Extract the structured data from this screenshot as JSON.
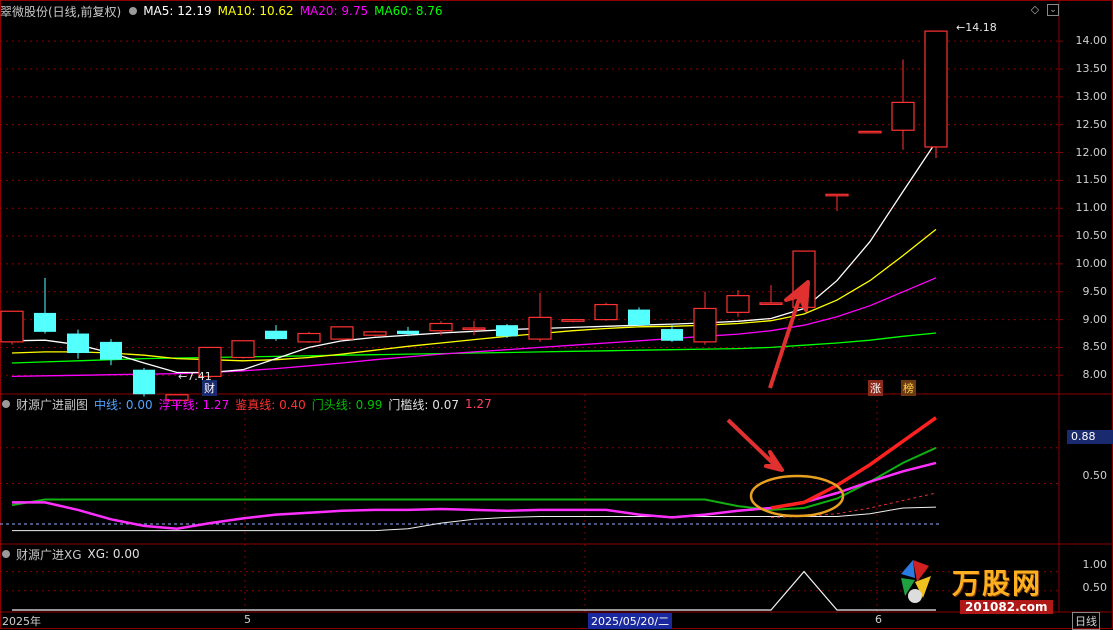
{
  "main_header": {
    "stock": "翠微股份(日线,前复权)",
    "ma5_label": "MA5:",
    "ma5_value": "12.19",
    "ma10_label": "MA10:",
    "ma10_value": "10.62",
    "ma20_label": "MA20:",
    "ma20_value": "9.75",
    "ma60_label": "MA60:",
    "ma60_value": "8.76"
  },
  "sub1_header": {
    "title": "财源广进副图",
    "mid_label": "中线:",
    "mid_value": "0.00",
    "float_label": "浮平线:",
    "float_value": "1.27",
    "true_label": "鉴真线:",
    "true_value": "0.40",
    "door_label": "门头线:",
    "door_value": "0.99",
    "thresh_label": "门槛线:",
    "thresh_value": "0.07",
    "thresh_extra": "1.27"
  },
  "sub2_header": {
    "title": "财源广进XG",
    "xg_label": "XG:",
    "xg_value": "0.00"
  },
  "price_axis": [
    "14.00",
    "13.50",
    "13.00",
    "12.50",
    "12.00",
    "11.50",
    "11.00",
    "10.50",
    "10.00",
    "9.50",
    "9.00",
    "8.50",
    "8.00"
  ],
  "sub1_axis": {
    "current": "0.88",
    "mid": "0.50"
  },
  "sub2_axis": [
    "1.00",
    "0.50"
  ],
  "annotations": {
    "high_price": "14.18",
    "low_price": "7.41",
    "cai_marker": "财",
    "zhang_marker": "涨",
    "bang_marker": "榜"
  },
  "bottom_axis": {
    "start": "2025年",
    "may": "5",
    "cursor_date": "2025/05/20/二",
    "june": "6",
    "period": "日线"
  },
  "watermark": {
    "brand": "万股网",
    "url": "201082.com"
  },
  "colors": {
    "up": "#ff3232",
    "down": "#54ffff",
    "ma5": "#ffffff",
    "ma10": "#ffff00",
    "ma20": "#ff00ff",
    "ma60": "#00ff00",
    "grid": "#8b0000"
  },
  "chart_data": {
    "type": "candlestick",
    "price_range": [
      7.7,
      14.2
    ],
    "candles": [
      {
        "o": 8.6,
        "h": 9.15,
        "l": 8.55,
        "c": 9.15
      },
      {
        "o": 9.12,
        "h": 9.75,
        "l": 8.75,
        "c": 8.78
      },
      {
        "o": 8.75,
        "h": 8.82,
        "l": 8.3,
        "c": 8.4
      },
      {
        "o": 8.6,
        "h": 8.65,
        "l": 8.18,
        "c": 8.28
      },
      {
        "o": 8.1,
        "h": 8.13,
        "l": 7.62,
        "c": 7.66
      },
      {
        "o": 7.55,
        "h": 7.63,
        "l": 7.41,
        "c": 7.65
      },
      {
        "o": 7.98,
        "h": 8.5,
        "l": 7.95,
        "c": 8.5
      },
      {
        "o": 8.32,
        "h": 8.62,
        "l": 8.3,
        "c": 8.62
      },
      {
        "o": 8.8,
        "h": 8.9,
        "l": 8.62,
        "c": 8.65
      },
      {
        "o": 8.6,
        "h": 8.78,
        "l": 8.58,
        "c": 8.75
      },
      {
        "o": 8.65,
        "h": 8.87,
        "l": 8.62,
        "c": 8.87
      },
      {
        "o": 8.72,
        "h": 8.8,
        "l": 8.7,
        "c": 8.78
      },
      {
        "o": 8.8,
        "h": 8.87,
        "l": 8.7,
        "c": 8.74
      },
      {
        "o": 8.8,
        "h": 8.97,
        "l": 8.72,
        "c": 8.93
      },
      {
        "o": 8.84,
        "h": 8.98,
        "l": 8.72,
        "c": 8.85
      },
      {
        "o": 8.9,
        "h": 8.92,
        "l": 8.67,
        "c": 8.7
      },
      {
        "o": 8.65,
        "h": 9.48,
        "l": 8.6,
        "c": 9.04
      },
      {
        "o": 8.97,
        "h": 9.0,
        "l": 8.95,
        "c": 9.0
      },
      {
        "o": 9.0,
        "h": 9.3,
        "l": 8.98,
        "c": 9.27
      },
      {
        "o": 9.18,
        "h": 9.22,
        "l": 8.88,
        "c": 8.9
      },
      {
        "o": 8.83,
        "h": 8.9,
        "l": 8.6,
        "c": 8.62
      },
      {
        "o": 8.6,
        "h": 9.5,
        "l": 8.55,
        "c": 9.2
      },
      {
        "o": 9.13,
        "h": 9.53,
        "l": 9.05,
        "c": 9.43
      },
      {
        "o": 9.3,
        "h": 9.62,
        "l": 9.3,
        "c": 9.3
      },
      {
        "o": 9.22,
        "h": 10.23,
        "l": 9.22,
        "c": 10.23
      },
      {
        "o": 11.25,
        "h": 11.25,
        "l": 10.95,
        "c": 11.25
      },
      {
        "o": 12.38,
        "h": 12.38,
        "l": 12.38,
        "c": 12.38
      },
      {
        "o": 12.4,
        "h": 13.67,
        "l": 12.05,
        "c": 12.9
      },
      {
        "o": 12.1,
        "h": 14.18,
        "l": 11.9,
        "c": 14.18
      }
    ],
    "ma5": [
      8.62,
      8.63,
      8.55,
      8.4,
      8.22,
      8.05,
      8.05,
      8.1,
      8.3,
      8.5,
      8.62,
      8.68,
      8.72,
      8.76,
      8.79,
      8.82,
      8.84,
      8.86,
      8.88,
      8.9,
      8.92,
      8.94,
      8.97,
      9.02,
      9.2,
      9.7,
      10.4,
      11.3,
      12.19
    ],
    "ma10": [
      8.4,
      8.42,
      8.42,
      8.4,
      8.36,
      8.3,
      8.28,
      8.26,
      8.28,
      8.32,
      8.38,
      8.45,
      8.52,
      8.58,
      8.64,
      8.7,
      8.75,
      8.8,
      8.84,
      8.87,
      8.88,
      8.9,
      8.93,
      8.98,
      9.1,
      9.35,
      9.7,
      10.15,
      10.62
    ],
    "ma20": [
      7.98,
      7.99,
      8.0,
      8.01,
      8.02,
      8.03,
      8.05,
      8.08,
      8.12,
      8.17,
      8.22,
      8.28,
      8.33,
      8.38,
      8.42,
      8.46,
      8.5,
      8.54,
      8.58,
      8.62,
      8.66,
      8.7,
      8.74,
      8.8,
      8.9,
      9.05,
      9.25,
      9.5,
      9.75
    ],
    "ma60": [
      8.22,
      8.24,
      8.26,
      8.28,
      8.3,
      8.31,
      8.32,
      8.33,
      8.34,
      8.35,
      8.36,
      8.37,
      8.38,
      8.39,
      8.4,
      8.41,
      8.42,
      8.43,
      8.44,
      8.45,
      8.46,
      8.47,
      8.48,
      8.5,
      8.54,
      8.58,
      8.63,
      8.7,
      8.76
    ],
    "sub1_range": [
      -0.1,
      1.25
    ],
    "sub1_magenta": [
      0.3,
      0.3,
      0.22,
      0.12,
      0.05,
      0.02,
      0.08,
      0.13,
      0.17,
      0.19,
      0.21,
      0.22,
      0.22,
      0.23,
      0.22,
      0.21,
      0.22,
      0.22,
      0.22,
      0.17,
      0.14,
      0.17,
      0.21,
      0.24,
      0.3,
      0.4,
      0.52,
      0.63,
      0.72
    ],
    "sub1_green": [
      0.27,
      0.33,
      0.33,
      0.33,
      0.33,
      0.33,
      0.33,
      0.33,
      0.33,
      0.33,
      0.33,
      0.33,
      0.33,
      0.33,
      0.33,
      0.33,
      0.33,
      0.33,
      0.33,
      0.33,
      0.33,
      0.33,
      0.26,
      0.22,
      0.24,
      0.34,
      0.52,
      0.72,
      0.88
    ],
    "sub1_red": [
      null,
      null,
      null,
      null,
      null,
      null,
      null,
      null,
      null,
      null,
      null,
      null,
      null,
      null,
      null,
      null,
      null,
      null,
      null,
      null,
      null,
      null,
      null,
      0.24,
      0.3,
      0.48,
      0.7,
      0.95,
      1.2
    ],
    "sub1_dashred": [
      null,
      null,
      null,
      null,
      null,
      null,
      null,
      null,
      null,
      null,
      null,
      null,
      null,
      null,
      null,
      null,
      null,
      null,
      null,
      null,
      null,
      null,
      null,
      0.14,
      0.15,
      0.18,
      0.24,
      0.32,
      0.4
    ],
    "sub1_white": [
      0.0,
      0.0,
      0.0,
      0.0,
      0.0,
      0.0,
      0.0,
      0.0,
      0.0,
      0.0,
      0.0,
      0.0,
      0.02,
      0.08,
      0.12,
      0.14,
      0.15,
      0.15,
      0.15,
      0.15,
      0.15,
      0.15,
      0.15,
      0.15,
      0.15,
      0.15,
      0.18,
      0.24,
      0.25
    ],
    "sub1_dashed": 0.07,
    "sub2_range": [
      0,
      1.25
    ],
    "sub2_xg": [
      0,
      0,
      0,
      0,
      0,
      0,
      0,
      0,
      0,
      0,
      0,
      0,
      0,
      0,
      0,
      0,
      0,
      0,
      0,
      0,
      0,
      0,
      0,
      0,
      1.0,
      0,
      0,
      0,
      0
    ]
  }
}
